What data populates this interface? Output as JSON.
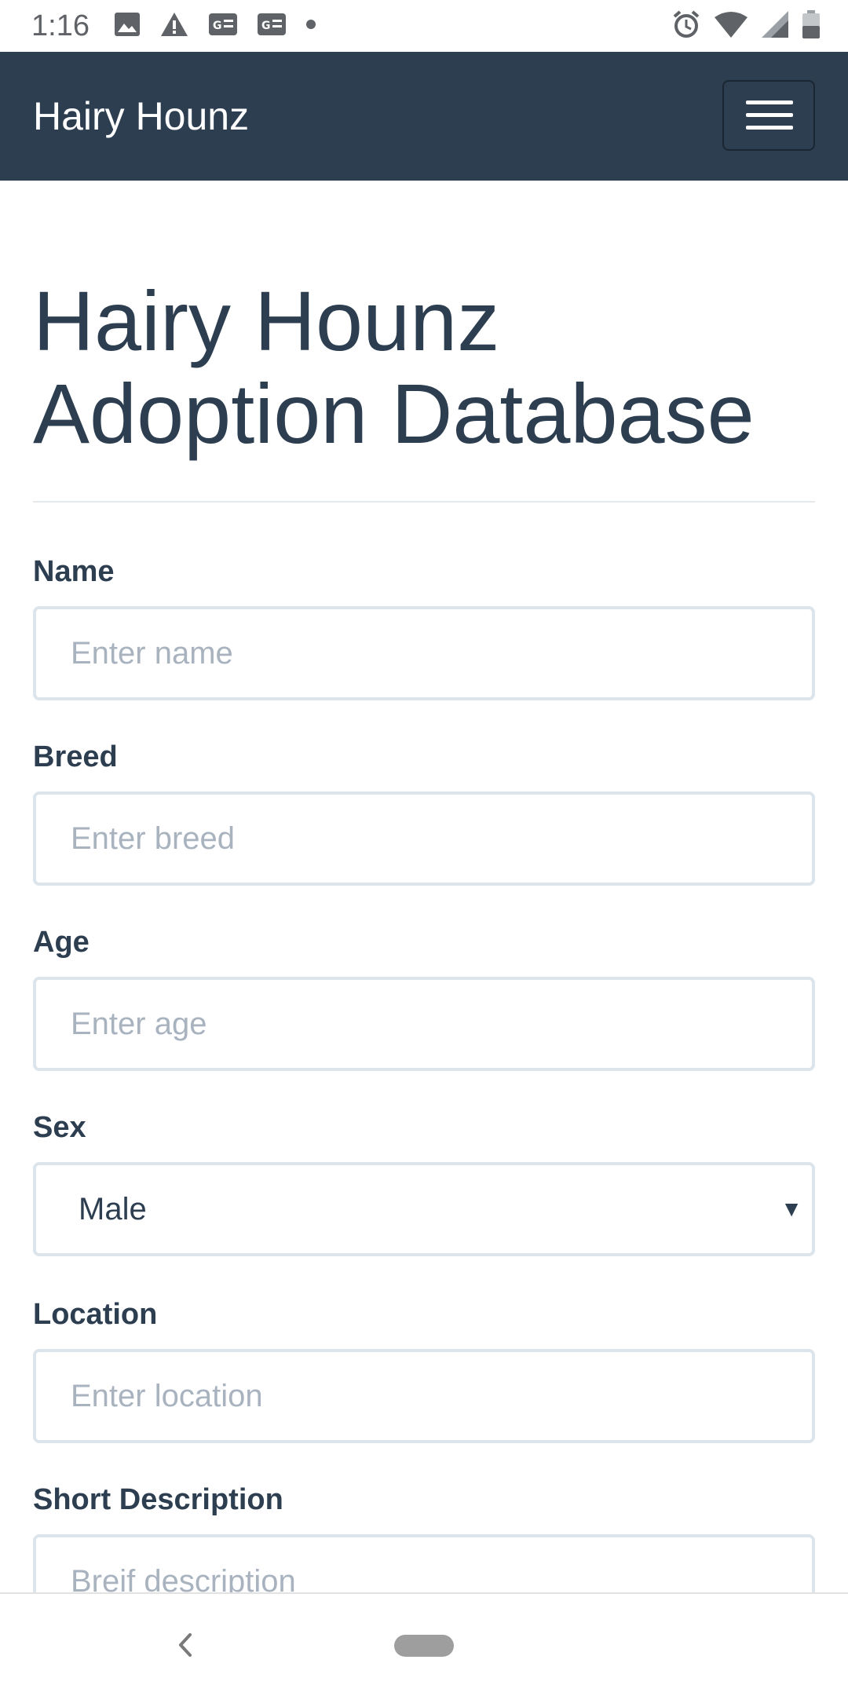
{
  "status_bar": {
    "time": "1:16",
    "left_icons": [
      "image-icon",
      "warning-icon",
      "news-icon",
      "news-icon",
      "dot-icon"
    ],
    "right_icons": [
      "alarm-icon",
      "wifi-icon",
      "signal-icon",
      "battery-icon"
    ]
  },
  "navbar": {
    "brand": "Hairy Hounz",
    "menu_icon": "hamburger-menu-icon",
    "background_color": "#2c3e50"
  },
  "page": {
    "title_line1": "Hairy Hounz",
    "title_line2": "Adoption Database"
  },
  "form": {
    "name": {
      "label": "Name",
      "placeholder": "Enter name",
      "value": ""
    },
    "breed": {
      "label": "Breed",
      "placeholder": "Enter breed",
      "value": ""
    },
    "age": {
      "label": "Age",
      "placeholder": "Enter age",
      "value": ""
    },
    "sex": {
      "label": "Sex",
      "selected": "Male"
    },
    "location": {
      "label": "Location",
      "placeholder": "Enter location",
      "value": ""
    },
    "description": {
      "label": "Short Description",
      "placeholder": "Breif description",
      "value": ""
    }
  },
  "bottom_nav": {
    "back_icon": "back-chevron-icon",
    "home_icon": "home-pill-icon"
  }
}
